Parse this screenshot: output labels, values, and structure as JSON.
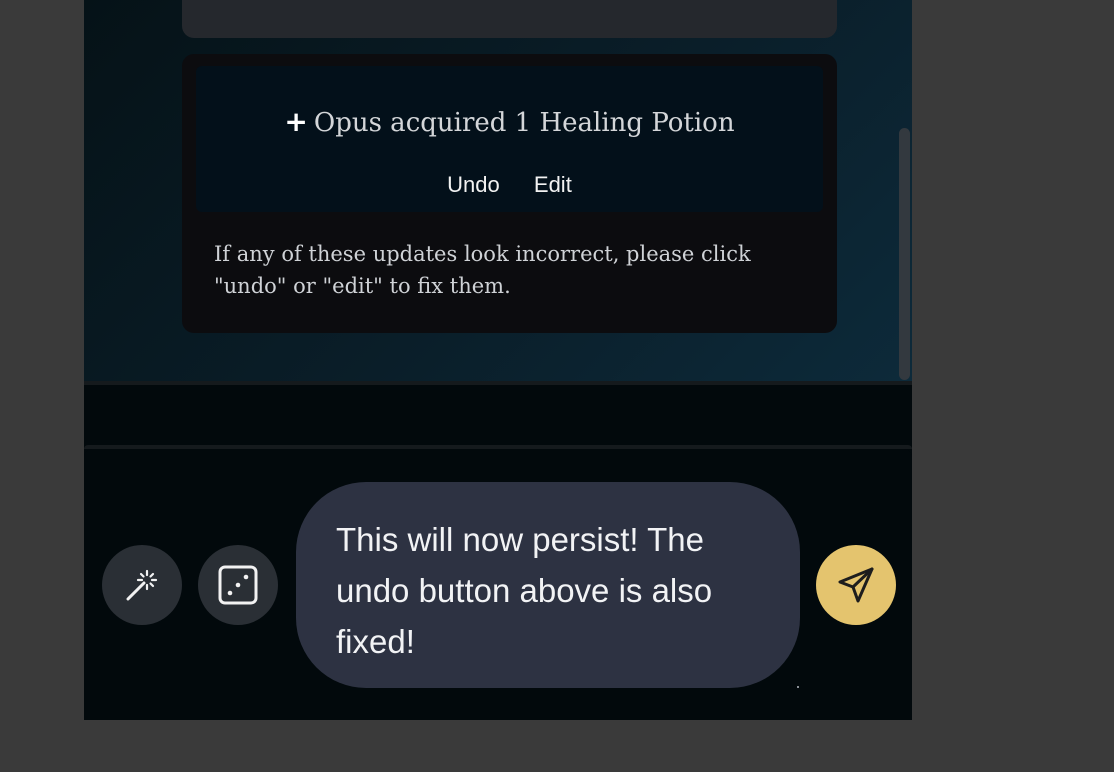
{
  "update_card": {
    "plus_symbol": "+",
    "message": "Opus acquired 1 Healing Potion",
    "undo_label": "Undo",
    "edit_label": "Edit",
    "note": "If any of these updates look incorrect, please click \"undo\" or \"edit\" to fix them."
  },
  "composer": {
    "message_text": "This will now persist! The undo button above is also fixed!",
    "wand_icon": "magic-wand-icon",
    "dice_icon": "dice-icon",
    "send_icon": "send-paper-plane-icon"
  },
  "colors": {
    "accent": "#e4c46e",
    "bubble": "#2d3242",
    "card": "#0c0c0f",
    "background": "#02090c"
  }
}
